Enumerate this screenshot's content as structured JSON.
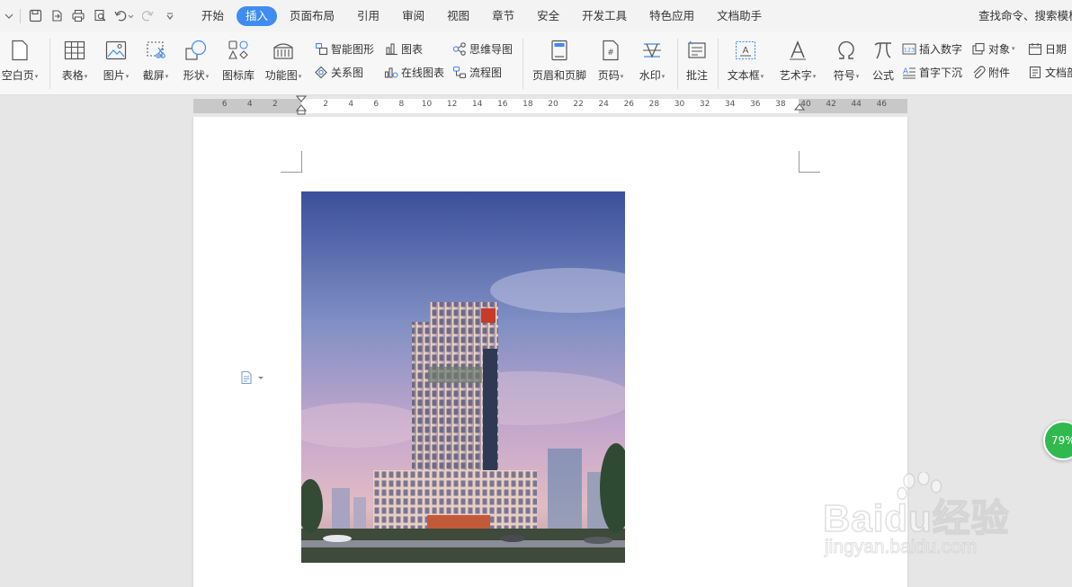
{
  "menubar": {
    "tabs": [
      "开始",
      "插入",
      "页面布局",
      "引用",
      "审阅",
      "视图",
      "章节",
      "安全",
      "开发工具",
      "特色应用",
      "文档助手"
    ],
    "active_tab": "插入",
    "search_text": "查找命令、搜索模板"
  },
  "ribbon": {
    "blank_page": "空白页",
    "table": "表格",
    "picture": "图片",
    "screenshot": "截屏",
    "shape": "形状",
    "icon_lib": "图标库",
    "func_chart": "功能图",
    "smart_shape": "智能图形",
    "chart": "图表",
    "mindmap": "思维导图",
    "relation": "关系图",
    "online_chart": "在线图表",
    "flowchart": "流程图",
    "header_footer": "页眉和页脚",
    "page_num": "页码",
    "watermark": "水印",
    "comment": "批注",
    "textbox": "文本框",
    "wordart": "艺术字",
    "symbol": "符号",
    "formula": "公式",
    "insert_number": "插入数字",
    "drop_cap": "首字下沉",
    "object": "对象",
    "attachment": "附件",
    "date": "日期",
    "doc_part": "文档部件"
  },
  "ruler": {
    "left_numbers": [
      "6",
      "4",
      "2"
    ],
    "right_numbers": [
      "2",
      "4",
      "6",
      "8",
      "10",
      "12",
      "14",
      "16",
      "18",
      "20",
      "22",
      "24",
      "26",
      "28",
      "30",
      "32",
      "34",
      "36",
      "38",
      "40",
      "42",
      "44",
      "46"
    ]
  },
  "badge": {
    "percent": "79%"
  },
  "watermark": {
    "brand": "Baidu经验",
    "url": "jingyan.baidu.com"
  },
  "colors": {
    "accent": "#3f8cf3",
    "badge": "#2fb94f"
  }
}
